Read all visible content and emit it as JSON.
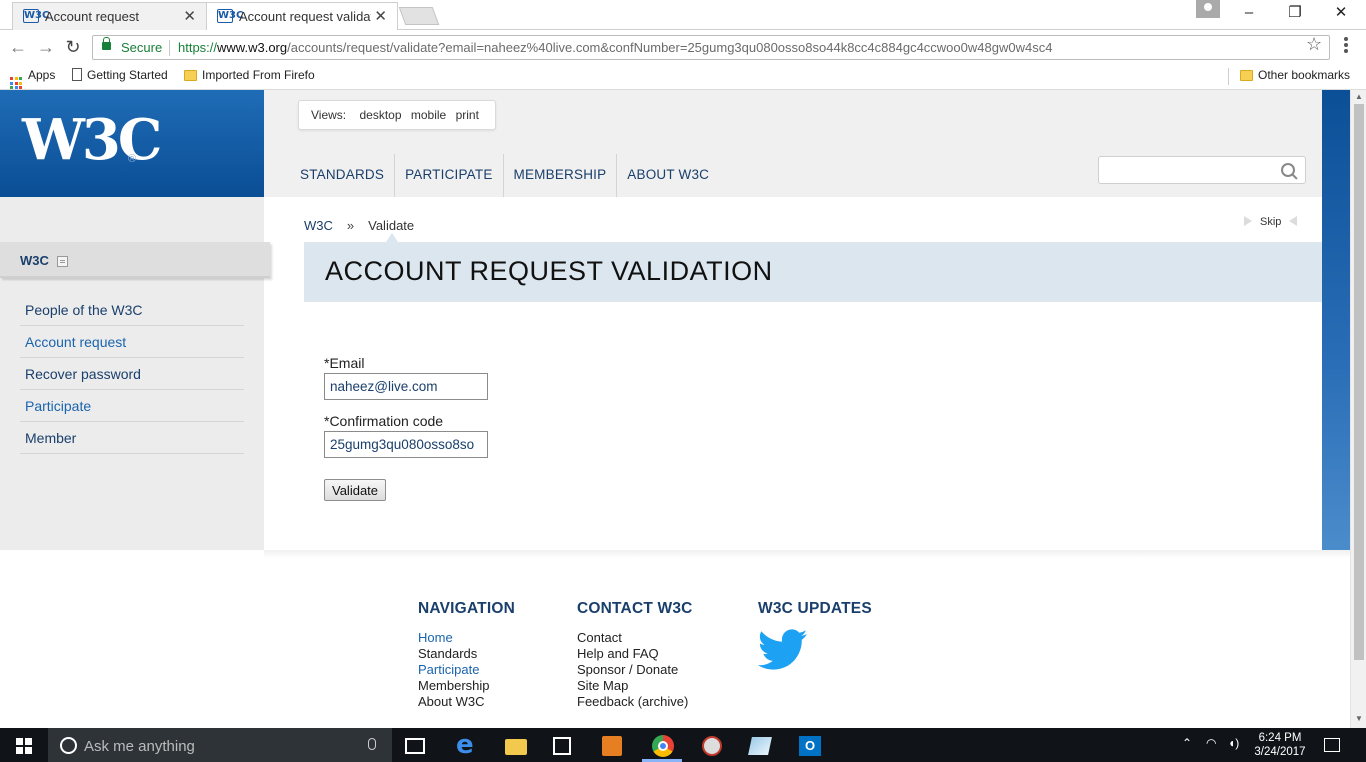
{
  "browser": {
    "tabs": [
      {
        "favicon": "W3C",
        "title": "Account request"
      },
      {
        "favicon": "W3C",
        "title": "Account request validatic"
      }
    ],
    "secure_label": "Secure",
    "url": {
      "scheme": "https://",
      "host": "www.w3.org",
      "path": "/accounts/request/validate?email=naheez%40live.com&confNumber=25gumg3qu080osso8so44k8cc4c884gc4ccwoo0w48gw0w4sc4"
    },
    "bookmarks": {
      "apps": "Apps",
      "getting_started": "Getting Started",
      "imported": "Imported From Firefo",
      "other": "Other bookmarks"
    }
  },
  "site": {
    "logo": "W3C",
    "views": {
      "label": "Views:",
      "options": [
        "desktop",
        "mobile",
        "print"
      ]
    },
    "topnav": [
      "STANDARDS",
      "PARTICIPATE",
      "MEMBERSHIP",
      "ABOUT W3C"
    ],
    "search": {
      "value": ""
    },
    "sidebar": {
      "heading": "W3C",
      "items": [
        {
          "label": "People of the W3C"
        },
        {
          "label": "Account request"
        },
        {
          "label": "Recover password"
        },
        {
          "label": "Participate"
        },
        {
          "label": "Member"
        }
      ]
    },
    "breadcrumb": {
      "root": "W3C",
      "separator": "»",
      "current": "Validate"
    },
    "skip": "Skip",
    "title": "ACCOUNT REQUEST VALIDATION",
    "form": {
      "email_label": "*Email",
      "email_value": "naheez@live.com",
      "code_label": "*Confirmation code",
      "code_value": "25gumg3qu080osso8so",
      "submit": "Validate"
    },
    "footer": {
      "navigation": {
        "heading": "NAVIGATION",
        "links": [
          "Home",
          "Standards",
          "Participate",
          "Membership",
          "About W3C"
        ]
      },
      "contact": {
        "heading": "CONTACT W3C",
        "links": [
          "Contact",
          "Help and FAQ",
          "Sponsor / Donate",
          "Site Map",
          "Feedback (archive)"
        ]
      },
      "updates": {
        "heading": "W3C UPDATES"
      }
    }
  },
  "taskbar": {
    "search_placeholder": "Ask me anything",
    "time": "6:24 PM",
    "date": "3/24/2017"
  },
  "colors": {
    "w3c_blue": "#0a4e95",
    "link_blue": "#1a64ad",
    "nav_dark": "#1a3f6b",
    "title_band": "#dbe6ef",
    "twitter": "#1da1f2"
  }
}
